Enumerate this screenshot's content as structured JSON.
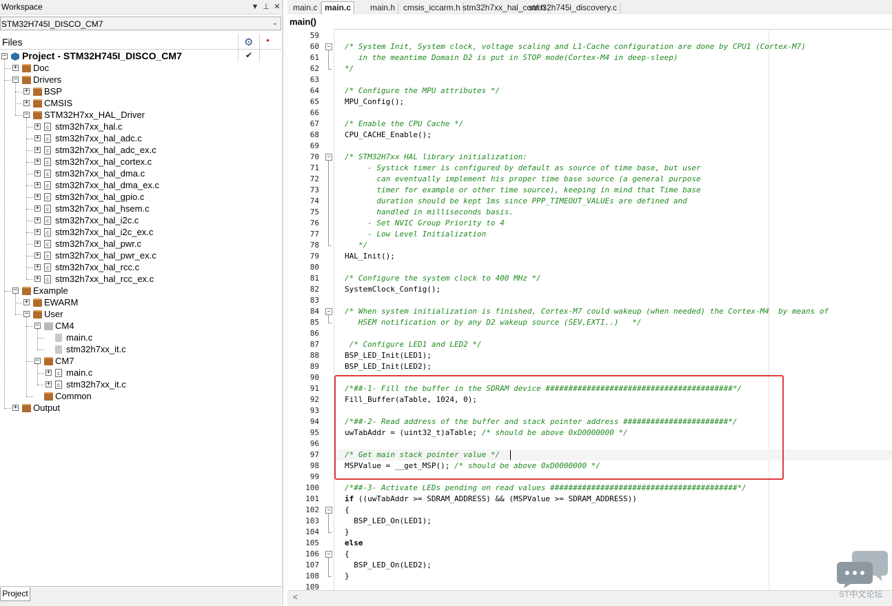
{
  "workspace": {
    "title": "Workspace",
    "config": "STM32H745I_DISCO_CM7",
    "files_header": "Files",
    "bottom_tab": "Project",
    "tree": [
      {
        "label": "Project - STM32H745I_DISCO_CM7",
        "kind": "project",
        "depth": 0,
        "toggle": "-"
      },
      {
        "label": "Doc",
        "kind": "folder",
        "depth": 1,
        "toggle": "+"
      },
      {
        "label": "Drivers",
        "kind": "folder",
        "depth": 1,
        "toggle": "-"
      },
      {
        "label": "BSP",
        "kind": "folder",
        "depth": 2,
        "toggle": "+"
      },
      {
        "label": "CMSIS",
        "kind": "folder",
        "depth": 2,
        "toggle": "+"
      },
      {
        "label": "STM32H7xx_HAL_Driver",
        "kind": "folder",
        "depth": 2,
        "toggle": "-"
      },
      {
        "label": "stm32h7xx_hal.c",
        "kind": "cfile",
        "depth": 3,
        "toggle": "+"
      },
      {
        "label": "stm32h7xx_hal_adc.c",
        "kind": "cfile",
        "depth": 3,
        "toggle": "+"
      },
      {
        "label": "stm32h7xx_hal_adc_ex.c",
        "kind": "cfile",
        "depth": 3,
        "toggle": "+"
      },
      {
        "label": "stm32h7xx_hal_cortex.c",
        "kind": "cfile",
        "depth": 3,
        "toggle": "+"
      },
      {
        "label": "stm32h7xx_hal_dma.c",
        "kind": "cfile",
        "depth": 3,
        "toggle": "+"
      },
      {
        "label": "stm32h7xx_hal_dma_ex.c",
        "kind": "cfile",
        "depth": 3,
        "toggle": "+"
      },
      {
        "label": "stm32h7xx_hal_gpio.c",
        "kind": "cfile",
        "depth": 3,
        "toggle": "+"
      },
      {
        "label": "stm32h7xx_hal_hsem.c",
        "kind": "cfile",
        "depth": 3,
        "toggle": "+"
      },
      {
        "label": "stm32h7xx_hal_i2c.c",
        "kind": "cfile",
        "depth": 3,
        "toggle": "+"
      },
      {
        "label": "stm32h7xx_hal_i2c_ex.c",
        "kind": "cfile",
        "depth": 3,
        "toggle": "+"
      },
      {
        "label": "stm32h7xx_hal_pwr.c",
        "kind": "cfile",
        "depth": 3,
        "toggle": "+"
      },
      {
        "label": "stm32h7xx_hal_pwr_ex.c",
        "kind": "cfile",
        "depth": 3,
        "toggle": "+"
      },
      {
        "label": "stm32h7xx_hal_rcc.c",
        "kind": "cfile",
        "depth": 3,
        "toggle": "+"
      },
      {
        "label": "stm32h7xx_hal_rcc_ex.c",
        "kind": "cfile",
        "depth": 3,
        "toggle": "+"
      },
      {
        "label": "Example",
        "kind": "folder",
        "depth": 1,
        "toggle": "-"
      },
      {
        "label": "EWARM",
        "kind": "folder",
        "depth": 2,
        "toggle": "+"
      },
      {
        "label": "User",
        "kind": "folder",
        "depth": 2,
        "toggle": "-"
      },
      {
        "label": "CM4",
        "kind": "folder-gray",
        "depth": 3,
        "toggle": "-"
      },
      {
        "label": "main.c",
        "kind": "gfile",
        "depth": 4,
        "toggle": ""
      },
      {
        "label": "stm32h7xx_it.c",
        "kind": "gfile",
        "depth": 4,
        "toggle": ""
      },
      {
        "label": "CM7",
        "kind": "folder",
        "depth": 3,
        "toggle": "-"
      },
      {
        "label": "main.c",
        "kind": "cfile",
        "depth": 4,
        "toggle": "+"
      },
      {
        "label": "stm32h7xx_it.c",
        "kind": "cfile",
        "depth": 4,
        "toggle": "+"
      },
      {
        "label": "Common",
        "kind": "folder",
        "depth": 3,
        "toggle": ""
      },
      {
        "label": "Output",
        "kind": "folder",
        "depth": 1,
        "toggle": "+"
      }
    ]
  },
  "editor": {
    "tabs": [
      {
        "label": "main.c",
        "active": false
      },
      {
        "label": "main.c",
        "active": true
      },
      {
        "label": "main.h",
        "active": false
      },
      {
        "label": "cmsis_iccarm.h",
        "active": false
      },
      {
        "label": "stm32h7xx_hal_conf.h",
        "active": false
      },
      {
        "label": "stm32h745i_discovery.c",
        "active": false
      }
    ],
    "function": "main()",
    "lines": [
      {
        "n": "59",
        "t": "",
        "s": ""
      },
      {
        "n": "60",
        "t": "/* System Init, System clock, voltage scaling and L1-Cache configuration are done by CPU1 (Cortex-M7)",
        "s": "comment",
        "fold": "open"
      },
      {
        "n": "61",
        "t": "   in the meantime Domain D2 is put in STOP mode(Cortex-M4 in deep-sleep)",
        "s": "comment"
      },
      {
        "n": "62",
        "t": "*/",
        "s": "comment",
        "fold": "end"
      },
      {
        "n": "63",
        "t": "",
        "s": ""
      },
      {
        "n": "64",
        "t": "/* Configure the MPU attributes */",
        "s": "comment"
      },
      {
        "n": "65",
        "t": "MPU_Config();",
        "s": ""
      },
      {
        "n": "66",
        "t": "",
        "s": ""
      },
      {
        "n": "67",
        "t": "/* Enable the CPU Cache */",
        "s": "comment"
      },
      {
        "n": "68",
        "t": "CPU_CACHE_Enable();",
        "s": ""
      },
      {
        "n": "69",
        "t": "",
        "s": ""
      },
      {
        "n": "70",
        "t": "/* STM32H7xx HAL library initialization:",
        "s": "comment",
        "fold": "open"
      },
      {
        "n": "71",
        "t": "     - Systick timer is configured by default as source of time base, but user",
        "s": "comment"
      },
      {
        "n": "72",
        "t": "       can eventually implement his proper time base source (a general purpose",
        "s": "comment"
      },
      {
        "n": "73",
        "t": "       timer for example or other time source), keeping in mind that Time base",
        "s": "comment"
      },
      {
        "n": "74",
        "t": "       duration should be kept 1ms since PPP_TIMEOUT_VALUEs are defined and",
        "s": "comment"
      },
      {
        "n": "75",
        "t": "       handled in milliseconds basis.",
        "s": "comment"
      },
      {
        "n": "76",
        "t": "     - Set NVIC Group Priority to 4",
        "s": "comment"
      },
      {
        "n": "77",
        "t": "     - Low Level Initialization",
        "s": "comment"
      },
      {
        "n": "78",
        "t": "   */",
        "s": "comment",
        "fold": "end"
      },
      {
        "n": "79",
        "t": "HAL_Init();",
        "s": ""
      },
      {
        "n": "80",
        "t": "",
        "s": ""
      },
      {
        "n": "81",
        "t": "/* Configure the system clock to 400 MHz */",
        "s": "comment"
      },
      {
        "n": "82",
        "t": "SystemClock_Config();",
        "s": ""
      },
      {
        "n": "83",
        "t": "",
        "s": ""
      },
      {
        "n": "84",
        "t": "/* When system initialization is finished, Cortex-M7 could wakeup (when needed) the Cortex-M4  by means of",
        "s": "comment",
        "fold": "open"
      },
      {
        "n": "85",
        "t": "   HSEM notification or by any D2 wakeup source (SEV,EXTI..)   */",
        "s": "comment",
        "fold": "end"
      },
      {
        "n": "86",
        "t": "",
        "s": ""
      },
      {
        "n": "87",
        "t": " /* Configure LED1 and LED2 */",
        "s": "comment"
      },
      {
        "n": "88",
        "t": "BSP_LED_Init(LED1);",
        "s": ""
      },
      {
        "n": "89",
        "t": "BSP_LED_Init(LED2);",
        "s": ""
      },
      {
        "n": "90",
        "t": "",
        "s": ""
      },
      {
        "n": "91",
        "t": "/*##-1- Fill the buffer in the SDRAM device #########################################*/",
        "s": "comment"
      },
      {
        "n": "92",
        "t": "Fill_Buffer(aTable, 1024, 0);",
        "s": ""
      },
      {
        "n": "93",
        "t": "",
        "s": ""
      },
      {
        "n": "94",
        "t": "/*##-2- Read address of the buffer and stack pointer address #######################*/",
        "s": "comment"
      },
      {
        "n": "95",
        "t": "uwTabAddr = (uint32_t)aTable; /* should be above 0xD0000000 */",
        "s": "mixed",
        "code": "uwTabAddr = (uint32_t)aTable; ",
        "cmt": "/* should be above 0xD0000000 */"
      },
      {
        "n": "96",
        "t": "",
        "s": ""
      },
      {
        "n": "97",
        "t": "/* Get main stack pointer value */",
        "s": "comment hi"
      },
      {
        "n": "98",
        "t": "MSPValue = __get_MSP(); /* should be above 0xD0000000 */",
        "s": "mixed",
        "code": "MSPValue = __get_MSP(); ",
        "cmt": "/* should be above 0xD0000000 */"
      },
      {
        "n": "99",
        "t": "",
        "s": ""
      },
      {
        "n": "100",
        "t": "/*##-3- Activate LEDs pending on read values #########################################*/",
        "s": "comment"
      },
      {
        "n": "101",
        "t": "if ((uwTabAddr >= SDRAM_ADDRESS) && (MSPValue >= SDRAM_ADDRESS))",
        "s": "if"
      },
      {
        "n": "102",
        "t": "{",
        "s": "",
        "fold": "open"
      },
      {
        "n": "103",
        "t": "  BSP_LED_On(LED1);",
        "s": ""
      },
      {
        "n": "104",
        "t": "}",
        "s": "",
        "fold": "end"
      },
      {
        "n": "105",
        "t": "else",
        "s": "kw"
      },
      {
        "n": "106",
        "t": "{",
        "s": "",
        "fold": "open"
      },
      {
        "n": "107",
        "t": "  BSP_LED_On(LED2);",
        "s": ""
      },
      {
        "n": "108",
        "t": "}",
        "s": "",
        "fold": "end"
      },
      {
        "n": "109",
        "t": "",
        "s": ""
      }
    ]
  },
  "watermark": "ST中文论坛",
  "colors": {
    "comment": "#1f8a1f",
    "highlight_box": "#e03a3a",
    "folder": "#b06c2c",
    "project_icon": "#2b6ea6"
  }
}
